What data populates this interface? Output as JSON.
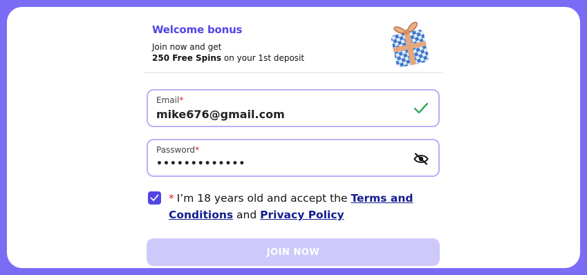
{
  "promo": {
    "title": "Welcome bonus",
    "line1": "Join now and get",
    "line2_bold": "250 Free Spins",
    "line2_rest": " on your 1st deposit"
  },
  "email": {
    "label": "Email",
    "required_mark": "*",
    "value": "mike676@gmail.com",
    "status_icon": "check-icon"
  },
  "password": {
    "label": "Password",
    "required_mark": "*",
    "masked_value": "•••••••••••••",
    "toggle_icon": "eye-slash-icon"
  },
  "consent": {
    "checked": true,
    "required_mark": "*",
    "text_before": "I’m 18 years old and accept the ",
    "terms_link": "Terms and Conditions",
    "text_middle": " and ",
    "privacy_link": "Privacy Policy"
  },
  "join_button": {
    "label": "JOIN NOW"
  },
  "colors": {
    "accent": "#5145e6",
    "frame": "#7b6cf6",
    "field_border": "#b7b0f7",
    "button_disabled": "#cdc9fb",
    "success": "#1fa24a",
    "required": "#e01818",
    "link": "#121c8e"
  }
}
